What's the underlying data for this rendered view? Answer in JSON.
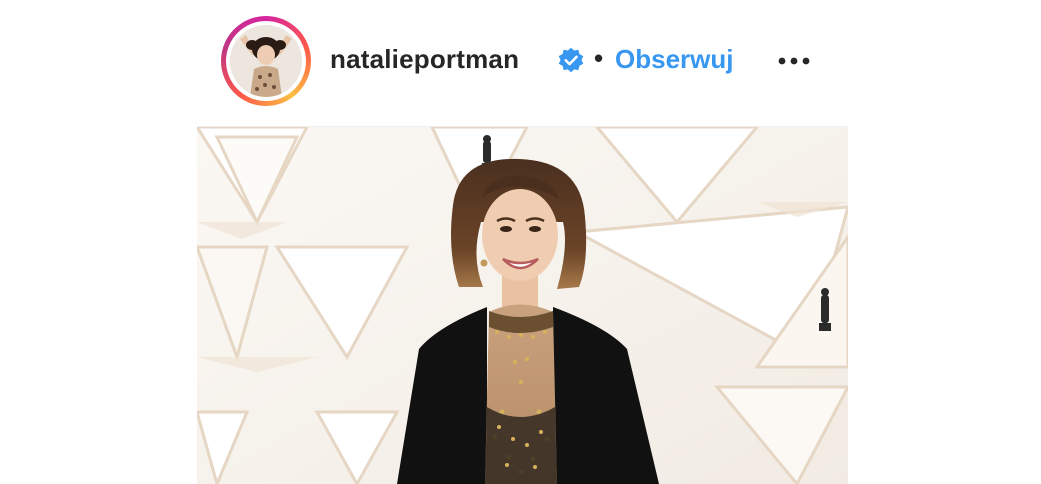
{
  "post": {
    "username": "natalieportman",
    "separator": "•",
    "follow_label": "Obserwuj"
  },
  "icons": {
    "verified": "verified-badge-icon",
    "more": "more-options-icon"
  },
  "colors": {
    "follow": "#3897f0",
    "verified": "#3897f0",
    "text": "#262626"
  }
}
